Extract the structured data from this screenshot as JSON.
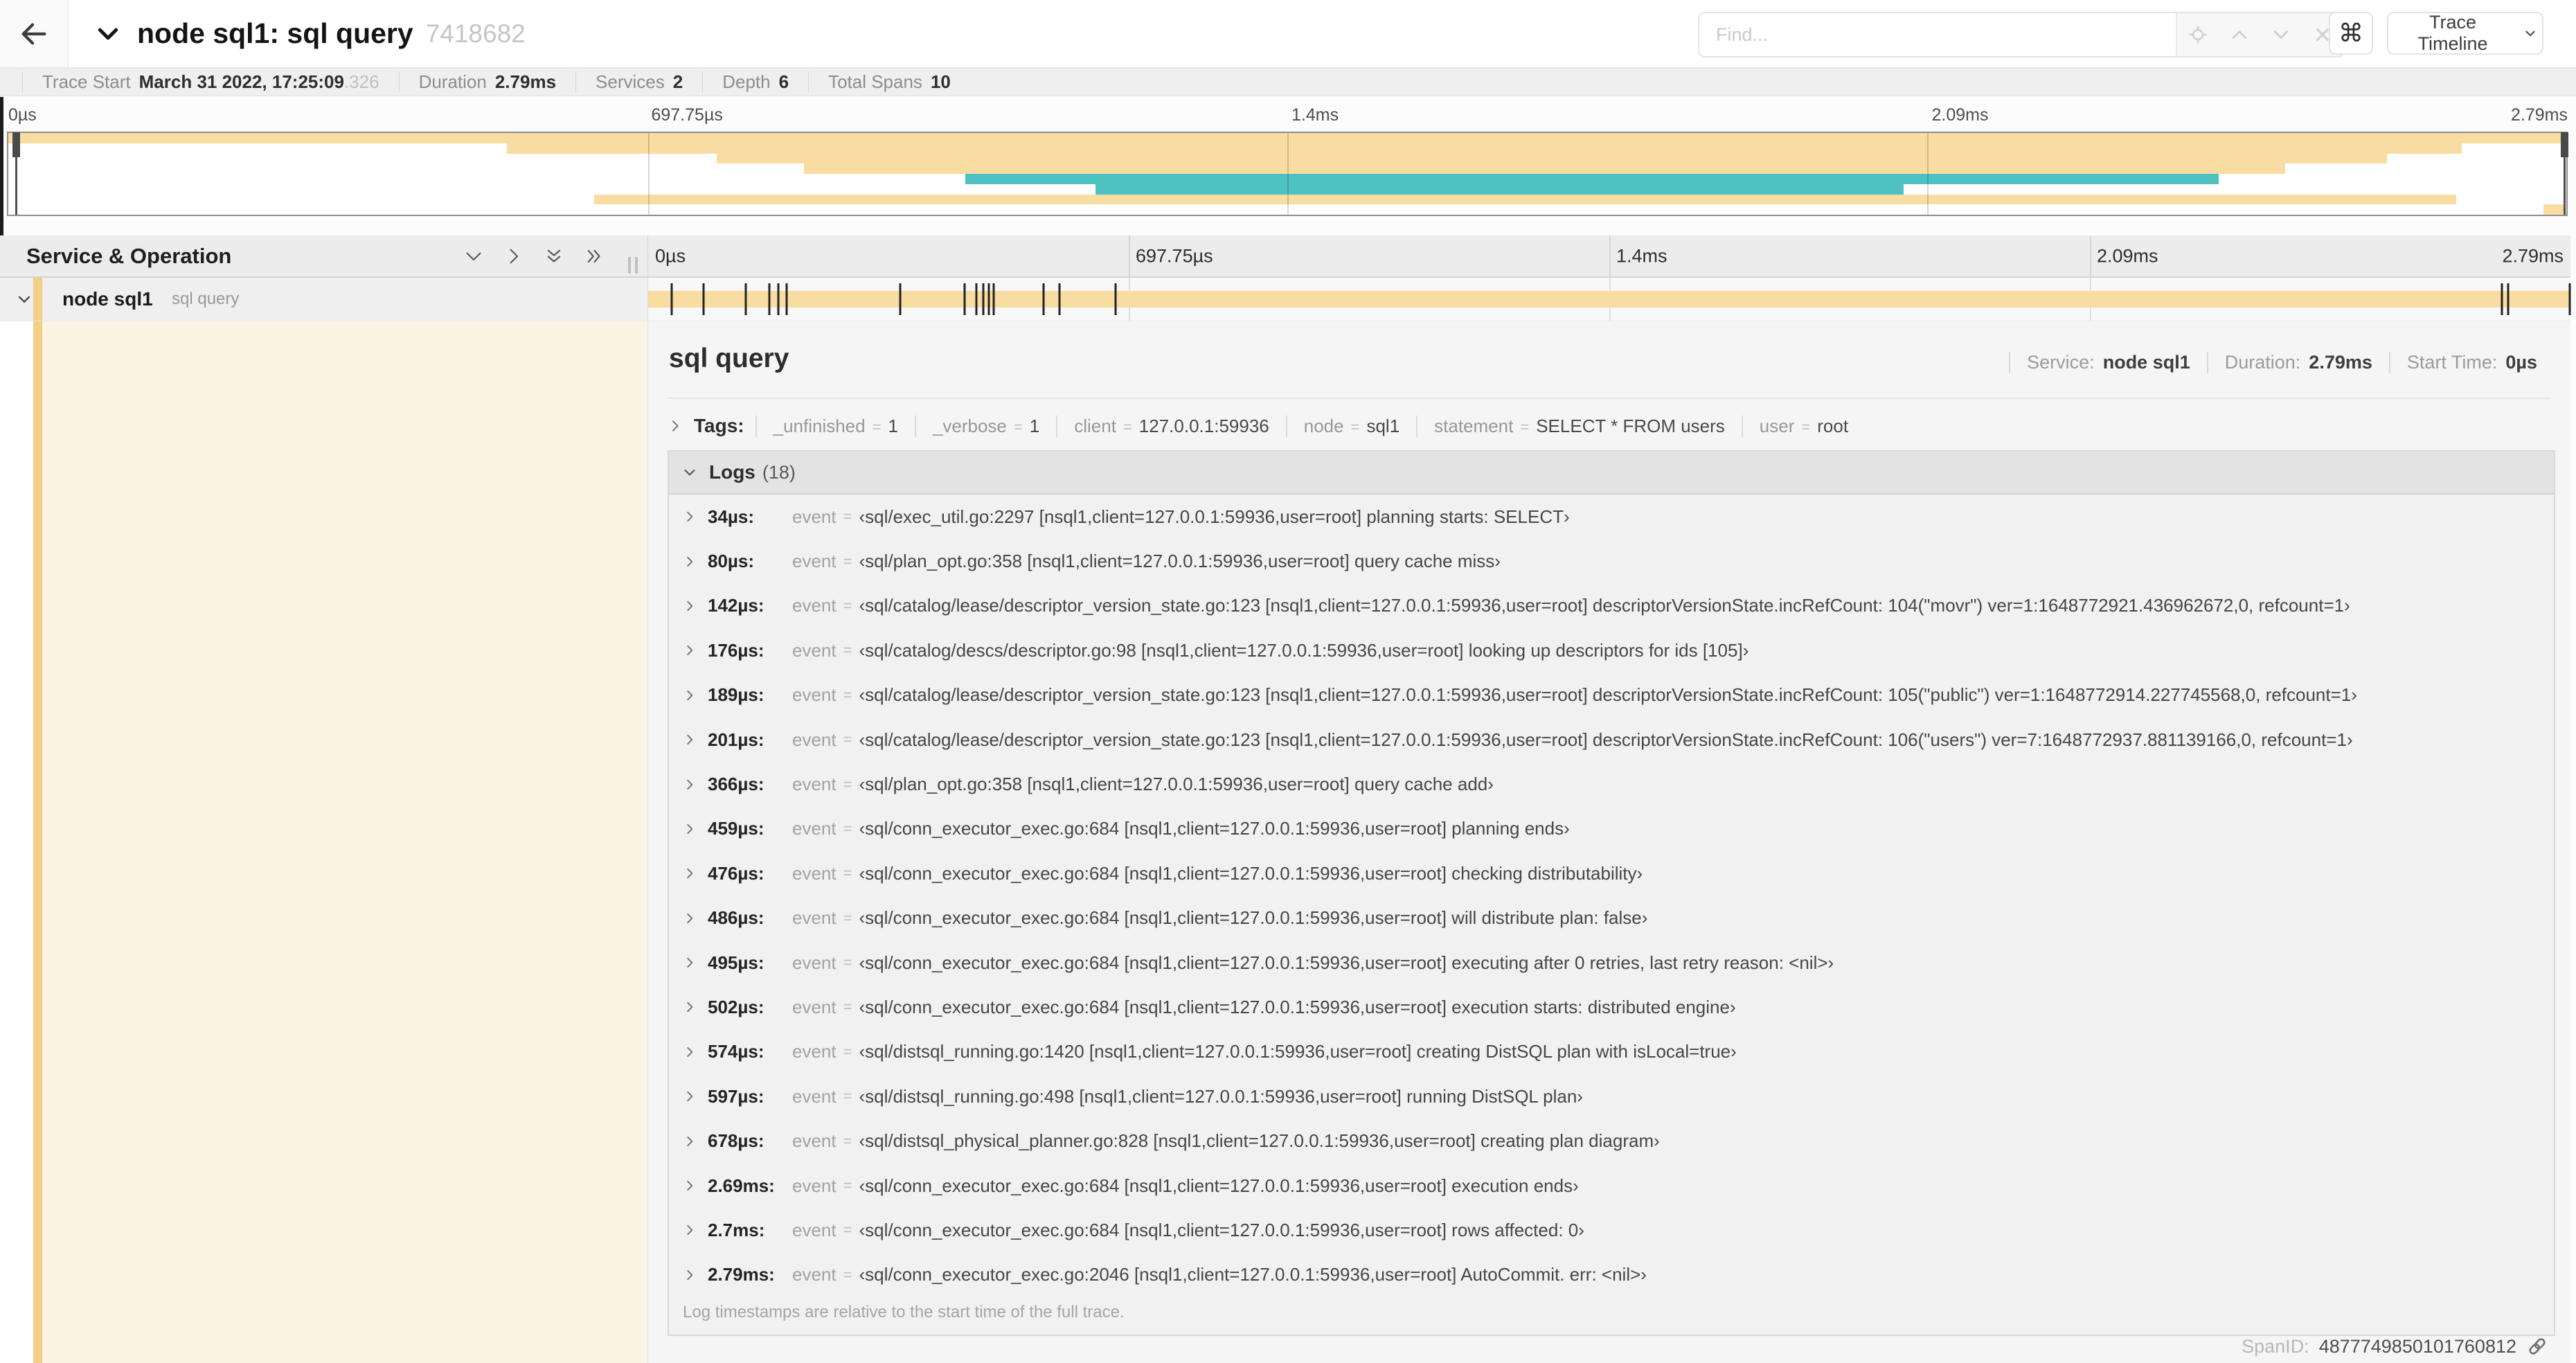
{
  "header": {
    "title": "node sql1: sql query",
    "trace_id": "7418682",
    "find_placeholder": "Find...",
    "find_icons": [
      "locate-icon",
      "chevron-up-icon",
      "chevron-down-icon",
      "clear-icon"
    ],
    "keyboard_shortcut": "⌘",
    "view_select": "Trace Timeline"
  },
  "metabar": {
    "items": [
      {
        "label": "Trace Start",
        "value": "March 31 2022, 17:25:09",
        "suffix": ".326"
      },
      {
        "label": "Duration",
        "value": "2.79ms",
        "suffix": ""
      },
      {
        "label": "Services",
        "value": "2",
        "suffix": ""
      },
      {
        "label": "Depth",
        "value": "6",
        "suffix": ""
      },
      {
        "label": "Total Spans",
        "value": "10",
        "suffix": ""
      }
    ]
  },
  "timeline": {
    "column_title": "Service & Operation",
    "ticks": [
      "0µs",
      "697.75µs",
      "1.4ms",
      "2.09ms",
      "2.79ms"
    ]
  },
  "colors": {
    "span_tan": "#f8dca1",
    "span_teal": "#4ec1c1",
    "accent_tan": "#f2ce86",
    "cream": "#fbf4e2"
  },
  "minimap": {
    "spans": [
      {
        "top": "0%",
        "left": "0%",
        "width": "100%",
        "color": "#f8dca1"
      },
      {
        "top": "12.5%",
        "left": "19.5%",
        "width": "76.4%",
        "color": "#f8dca1"
      },
      {
        "top": "25%",
        "left": "27.7%",
        "width": "65.3%",
        "color": "#f8dca1"
      },
      {
        "top": "37.5%",
        "left": "31.1%",
        "width": "57.9%",
        "color": "#f8dca1"
      },
      {
        "top": "50%",
        "left": "37.4%",
        "width": "49%",
        "color": "#4ec1c1"
      },
      {
        "top": "62.5%",
        "left": "42.5%",
        "width": "31.6%",
        "color": "#4ec1c1"
      },
      {
        "top": "75%",
        "left": "22.9%",
        "width": "72.8%",
        "color": "#f8dca1"
      },
      {
        "top": "87.5%",
        "left": "99.1%",
        "width": "0.8%",
        "color": "#f8dca1"
      }
    ]
  },
  "span_row": {
    "service": "node sql1",
    "operation": "sql query",
    "ticks": [
      {
        "left": "1.22%"
      },
      {
        "left": "2.87%"
      },
      {
        "left": "5.09%"
      },
      {
        "left": "6.31%"
      },
      {
        "left": "6.77%"
      },
      {
        "left": "7.2%"
      },
      {
        "left": "13.12%"
      },
      {
        "left": "16.45%"
      },
      {
        "left": "17.06%"
      },
      {
        "left": "17.42%"
      },
      {
        "left": "17.74%"
      },
      {
        "left": "17.99%"
      },
      {
        "left": "20.57%"
      },
      {
        "left": "21.4%"
      },
      {
        "left": "24.3%"
      },
      {
        "left": "96.42%"
      },
      {
        "left": "96.77%"
      },
      {
        "left": "99.95%"
      }
    ]
  },
  "detail": {
    "title": "sql query",
    "meta": [
      {
        "label": "Service:",
        "value": "node sql1"
      },
      {
        "label": "Duration:",
        "value": "2.79ms"
      },
      {
        "label": "Start Time:",
        "value": "0µs"
      }
    ],
    "tags": {
      "title": "Tags:",
      "items": [
        {
          "key": "_unfinished",
          "eq": "=",
          "value": "1"
        },
        {
          "key": "_verbose",
          "eq": "=",
          "value": "1"
        },
        {
          "key": "client",
          "eq": "=",
          "value": "127.0.0.1:59936"
        },
        {
          "key": "node",
          "eq": "=",
          "value": "sql1"
        },
        {
          "key": "statement",
          "eq": "=",
          "value": "SELECT * FROM users"
        },
        {
          "key": "user",
          "eq": "=",
          "value": "root"
        }
      ]
    },
    "logs": {
      "title": "Logs",
      "count": "(18)",
      "entries": [
        {
          "time": "34µs:",
          "key": "event",
          "eq": "=",
          "value": "‹sql/exec_util.go:2297 [nsql1,client=127.0.0.1:59936,user=root] planning starts: SELECT›"
        },
        {
          "time": "80µs:",
          "key": "event",
          "eq": "=",
          "value": "‹sql/plan_opt.go:358 [nsql1,client=127.0.0.1:59936,user=root] query cache miss›"
        },
        {
          "time": "142µs:",
          "key": "event",
          "eq": "=",
          "value": "‹sql/catalog/lease/descriptor_version_state.go:123 [nsql1,client=127.0.0.1:59936,user=root] descriptorVersionState.incRefCount: 104(\"movr\") ver=1:1648772921.436962672,0, refcount=1›"
        },
        {
          "time": "176µs:",
          "key": "event",
          "eq": "=",
          "value": "‹sql/catalog/descs/descriptor.go:98 [nsql1,client=127.0.0.1:59936,user=root] looking up descriptors for ids [105]›"
        },
        {
          "time": "189µs:",
          "key": "event",
          "eq": "=",
          "value": "‹sql/catalog/lease/descriptor_version_state.go:123 [nsql1,client=127.0.0.1:59936,user=root] descriptorVersionState.incRefCount: 105(\"public\") ver=1:1648772914.227745568,0, refcount=1›"
        },
        {
          "time": "201µs:",
          "key": "event",
          "eq": "=",
          "value": "‹sql/catalog/lease/descriptor_version_state.go:123 [nsql1,client=127.0.0.1:59936,user=root] descriptorVersionState.incRefCount: 106(\"users\") ver=7:1648772937.881139166,0, refcount=1›"
        },
        {
          "time": "366µs:",
          "key": "event",
          "eq": "=",
          "value": "‹sql/plan_opt.go:358 [nsql1,client=127.0.0.1:59936,user=root] query cache add›"
        },
        {
          "time": "459µs:",
          "key": "event",
          "eq": "=",
          "value": "‹sql/conn_executor_exec.go:684 [nsql1,client=127.0.0.1:59936,user=root] planning ends›"
        },
        {
          "time": "476µs:",
          "key": "event",
          "eq": "=",
          "value": "‹sql/conn_executor_exec.go:684 [nsql1,client=127.0.0.1:59936,user=root] checking distributability›"
        },
        {
          "time": "486µs:",
          "key": "event",
          "eq": "=",
          "value": "‹sql/conn_executor_exec.go:684 [nsql1,client=127.0.0.1:59936,user=root] will distribute plan: false›"
        },
        {
          "time": "495µs:",
          "key": "event",
          "eq": "=",
          "value": "‹sql/conn_executor_exec.go:684 [nsql1,client=127.0.0.1:59936,user=root] executing after 0 retries, last retry reason: <nil>›"
        },
        {
          "time": "502µs:",
          "key": "event",
          "eq": "=",
          "value": "‹sql/conn_executor_exec.go:684 [nsql1,client=127.0.0.1:59936,user=root] execution starts: distributed engine›"
        },
        {
          "time": "574µs:",
          "key": "event",
          "eq": "=",
          "value": "‹sql/distsql_running.go:1420 [nsql1,client=127.0.0.1:59936,user=root] creating DistSQL plan with isLocal=true›"
        },
        {
          "time": "597µs:",
          "key": "event",
          "eq": "=",
          "value": "‹sql/distsql_running.go:498 [nsql1,client=127.0.0.1:59936,user=root] running DistSQL plan›"
        },
        {
          "time": "678µs:",
          "key": "event",
          "eq": "=",
          "value": "‹sql/distsql_physical_planner.go:828 [nsql1,client=127.0.0.1:59936,user=root] creating plan diagram›"
        },
        {
          "time": "2.69ms:",
          "key": "event",
          "eq": "=",
          "value": "‹sql/conn_executor_exec.go:684 [nsql1,client=127.0.0.1:59936,user=root] execution ends›"
        },
        {
          "time": "2.7ms:",
          "key": "event",
          "eq": "=",
          "value": "‹sql/conn_executor_exec.go:684 [nsql1,client=127.0.0.1:59936,user=root] rows affected: 0›"
        },
        {
          "time": "2.79ms:",
          "key": "event",
          "eq": "=",
          "value": "‹sql/conn_executor_exec.go:2046 [nsql1,client=127.0.0.1:59936,user=root] AutoCommit. err: <nil>›"
        }
      ],
      "note": "Log timestamps are relative to the start time of the full trace."
    },
    "span_id": {
      "label": "SpanID:",
      "value": "4877749850101760812"
    }
  }
}
